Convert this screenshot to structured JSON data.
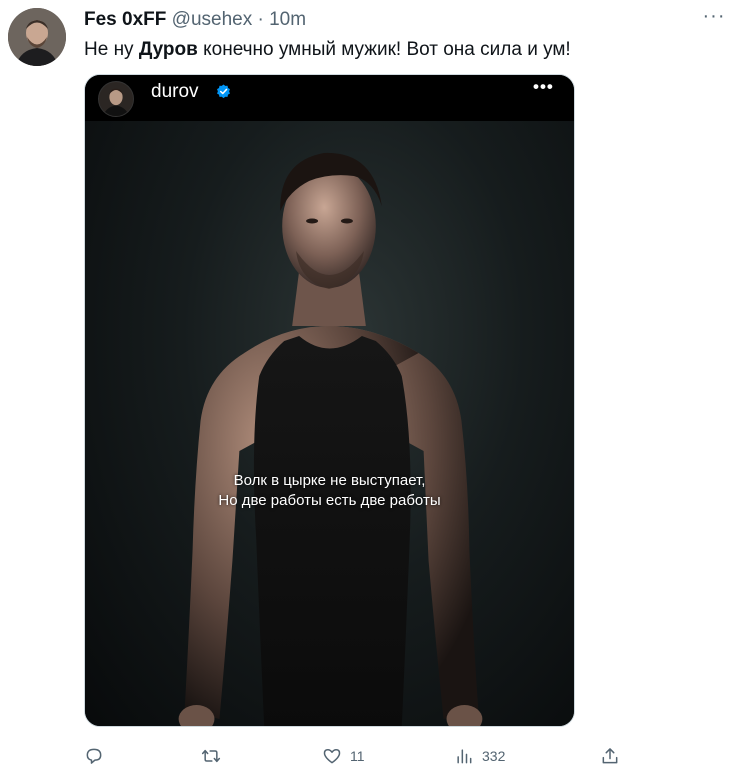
{
  "tweet": {
    "author_name": "Fes 0xFF",
    "author_handle": "@usehex",
    "separator": "·",
    "timestamp": "10m",
    "text_prefix": "Не ну ",
    "text_bold": "Дуров",
    "text_suffix": " конечно умный мужик! Вот она сила и ум!",
    "more_label": "···"
  },
  "embedded_post": {
    "username": "durov",
    "more_label": "•••",
    "caption_line1": "Волк в цырке не выступает,",
    "caption_line2": "Но две работы есть две работы"
  },
  "actions": {
    "reply_count": "",
    "retweet_count": "",
    "like_count": "11",
    "views_count": "332"
  },
  "colors": {
    "text": "#0f1419",
    "secondary": "#536471",
    "verified": "#0095f6",
    "media_bg": "#000000"
  }
}
